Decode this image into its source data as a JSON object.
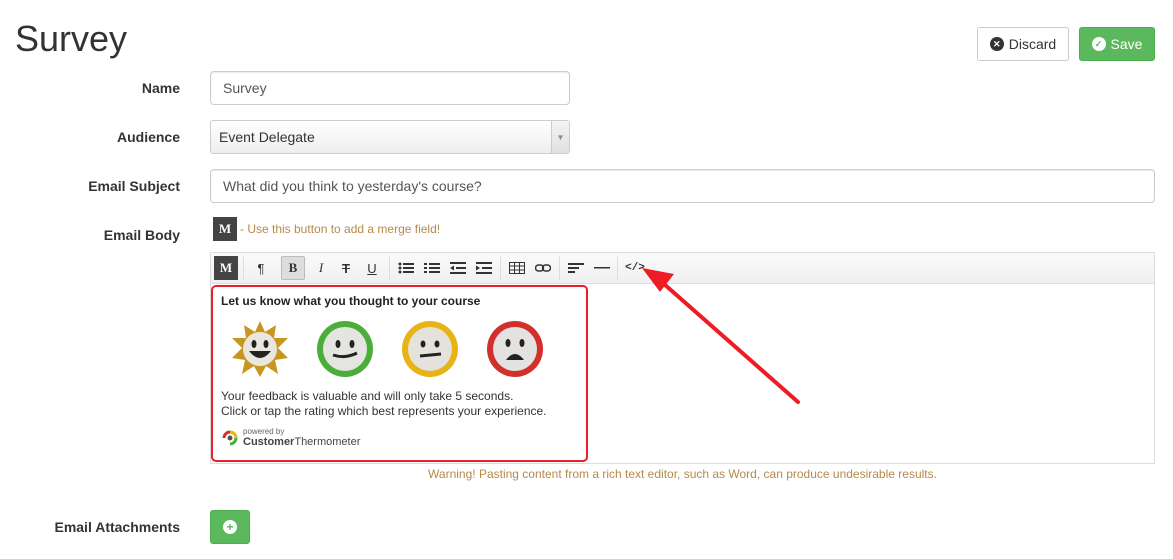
{
  "page": {
    "title": "Survey"
  },
  "actions": {
    "discard_label": "Discard",
    "save_label": "Save"
  },
  "form": {
    "name_label": "Name",
    "name_value": "Survey",
    "audience_label": "Audience",
    "audience_value": "Event Delegate",
    "subject_label": "Email Subject",
    "subject_value": "What did you think to yesterday's course?",
    "body_label": "Email Body",
    "attachments_label": "Email Attachments"
  },
  "merge": {
    "button_label": "M",
    "hint": "- Use this button to add a merge field!"
  },
  "toolbar": {
    "merge": "M",
    "paragraph": "¶",
    "bold": "B",
    "italic": "I",
    "strike": "T",
    "underline": "U",
    "code_view": "</>"
  },
  "editor_content": {
    "heading": "Let us know what you thought to your course",
    "line1": "Your feedback is valuable and will only take 5 seconds.",
    "line2": "Click or tap the rating which best represents your experience.",
    "powered_by": "powered by",
    "brand_bold": "Customer",
    "brand_rest": "Thermometer"
  },
  "warning": "Warning! Pasting content from a rich text editor, such as Word, can produce undesirable results.",
  "colors": {
    "accent_green": "#5cb85c",
    "highlight_red": "#e8202a",
    "hint_brown": "#b58a4a"
  }
}
